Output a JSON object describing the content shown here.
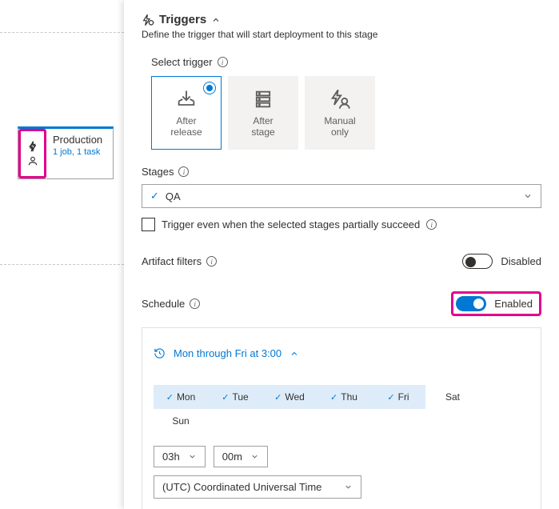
{
  "stage_card": {
    "title": "Production",
    "subtitle": "1 job, 1 task"
  },
  "panel": {
    "title": "Triggers",
    "description": "Define the trigger that will start deployment to this stage"
  },
  "select_trigger": {
    "label": "Select trigger",
    "options": {
      "after_release": "After\nrelease",
      "after_stage": "After\nstage",
      "manual_only": "Manual\nonly"
    }
  },
  "stages": {
    "label": "Stages",
    "selected": "QA"
  },
  "partial_succeed": {
    "label": "Trigger even when the selected stages partially succeed"
  },
  "artifact_filters": {
    "label": "Artifact filters",
    "state": "Disabled"
  },
  "schedule": {
    "label": "Schedule",
    "state": "Enabled",
    "summary": "Mon through Fri at 3:00",
    "days": [
      {
        "label": "Mon",
        "selected": true
      },
      {
        "label": "Tue",
        "selected": true
      },
      {
        "label": "Wed",
        "selected": true
      },
      {
        "label": "Thu",
        "selected": true
      },
      {
        "label": "Fri",
        "selected": true
      },
      {
        "label": "Sat",
        "selected": false
      },
      {
        "label": "Sun",
        "selected": false
      }
    ],
    "hour": "03h",
    "minute": "00m",
    "timezone": "(UTC) Coordinated Universal Time"
  }
}
